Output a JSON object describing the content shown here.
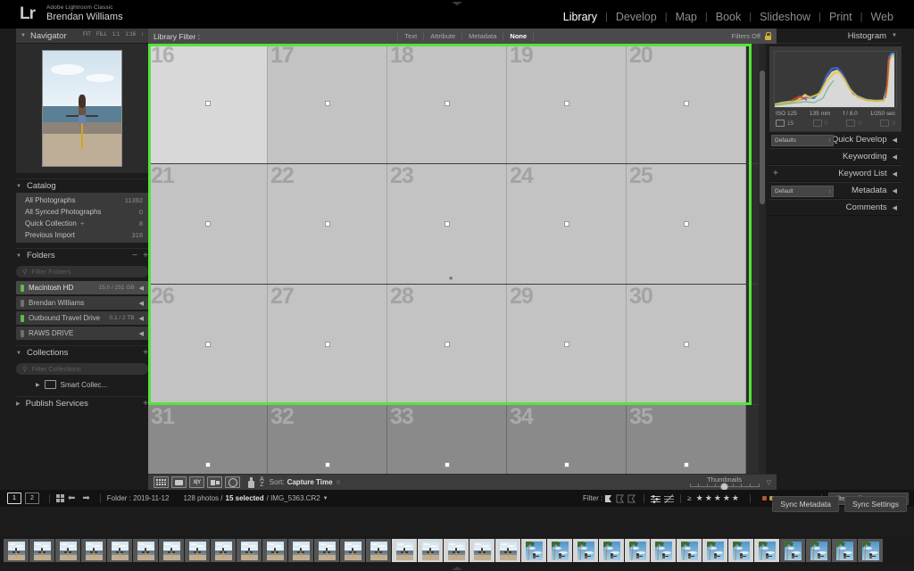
{
  "app": {
    "logo": "Lr",
    "product": "Adobe Lightroom Classic",
    "user": "Brendan Williams"
  },
  "modules": [
    {
      "label": "Library",
      "active": true
    },
    {
      "label": "Develop",
      "active": false
    },
    {
      "label": "Map",
      "active": false
    },
    {
      "label": "Book",
      "active": false
    },
    {
      "label": "Slideshow",
      "active": false
    },
    {
      "label": "Print",
      "active": false
    },
    {
      "label": "Web",
      "active": false
    }
  ],
  "left": {
    "navigator": {
      "title": "Navigator",
      "zoom_levels": [
        "FIT",
        "FILL",
        "1:1",
        "1:16"
      ]
    },
    "catalog": {
      "title": "Catalog",
      "rows": [
        {
          "label": "All Photographs",
          "count": "11392"
        },
        {
          "label": "All Synced Photographs",
          "count": "0"
        },
        {
          "label": "Quick Collection",
          "count": "8",
          "plus": "+"
        },
        {
          "label": "Previous Import",
          "count": "318"
        }
      ]
    },
    "folders": {
      "title": "Folders",
      "filter_placeholder": "Filter Folders",
      "items": [
        {
          "label": "Macintosh HD",
          "capacity": "15.0 / 251 GB",
          "selected": true,
          "online": true
        },
        {
          "label": "Brendan Williams",
          "capacity": "",
          "selected": false,
          "online": false
        },
        {
          "label": "Outbound Travel Drive",
          "capacity": "0.1 / 2 TB",
          "selected": false,
          "online": true
        },
        {
          "label": "RAWS DRIVE",
          "capacity": "",
          "selected": false,
          "online": false
        }
      ]
    },
    "collections": {
      "title": "Collections",
      "filter_placeholder": "Filter Collections",
      "items": [
        {
          "label": "Smart Collec..."
        }
      ]
    },
    "publish": {
      "title": "Publish Services"
    }
  },
  "right": {
    "histogram": {
      "title": "Histogram",
      "iso": "ISO 125",
      "focal": "135 mm",
      "aperture": "f / 8.0",
      "shutter": "1/250 sec",
      "counts": [
        {
          "value": "15",
          "icon": "photo-icon",
          "dim": false
        },
        {
          "value": "0",
          "icon": "stack-icon",
          "dim": true
        },
        {
          "value": "0",
          "icon": "video-icon",
          "dim": true
        },
        {
          "value": "0",
          "icon": "virtual-copy-icon",
          "dim": true
        }
      ]
    },
    "sections": [
      {
        "label": "Quick Develop",
        "preset": "Defaults"
      },
      {
        "label": "Keywording",
        "preset": ""
      },
      {
        "label": "Keyword List",
        "preset": "",
        "plus": "+"
      },
      {
        "label": "Metadata",
        "preset": "Default"
      },
      {
        "label": "Comments",
        "preset": ""
      }
    ],
    "sync": {
      "metadata_label": "Sync Metadata",
      "settings_label": "Sync Settings"
    }
  },
  "library_filter": {
    "label": "Library Filter :",
    "tabs": [
      {
        "label": "Text",
        "active": false
      },
      {
        "label": "Attribute",
        "active": false
      },
      {
        "label": "Metadata",
        "active": false
      },
      {
        "label": "None",
        "active": true
      }
    ],
    "filters_off": "Filters Off",
    "lock_icon": "lock-icon"
  },
  "grid": {
    "selection_color": "#53e53a",
    "rows": [
      {
        "selected": true,
        "cells": [
          {
            "index": "16",
            "active": true,
            "scene": "beach-rear"
          },
          {
            "index": "17",
            "active": false,
            "scene": "beach-rear"
          },
          {
            "index": "18",
            "active": false,
            "scene": "beach-rear"
          },
          {
            "index": "19",
            "active": false,
            "scene": "beach-rear"
          },
          {
            "index": "20",
            "active": false,
            "scene": "beach-rear"
          }
        ]
      },
      {
        "selected": true,
        "cells": [
          {
            "index": "21",
            "active": false,
            "scene": "beach-front"
          },
          {
            "index": "22",
            "active": false,
            "scene": "beach-front"
          },
          {
            "index": "23",
            "active": false,
            "scene": "beach-wide",
            "star": "★"
          },
          {
            "index": "24",
            "active": false,
            "scene": "beach-side"
          },
          {
            "index": "25",
            "active": false,
            "scene": "palm-portrait"
          }
        ]
      },
      {
        "selected": true,
        "cells": [
          {
            "index": "26",
            "active": false,
            "scene": "palm-portrait"
          },
          {
            "index": "27",
            "active": false,
            "scene": "palm-bike"
          },
          {
            "index": "28",
            "active": false,
            "scene": "palm-bike"
          },
          {
            "index": "29",
            "active": false,
            "scene": "palm-bike"
          },
          {
            "index": "30",
            "active": false,
            "scene": "palm-sun"
          }
        ]
      },
      {
        "selected": false,
        "cells": [
          {
            "index": "31",
            "active": false,
            "scene": "palm-low"
          },
          {
            "index": "32",
            "active": false,
            "scene": "palm-low"
          },
          {
            "index": "33",
            "active": false,
            "scene": "palm-low"
          },
          {
            "index": "34",
            "active": false,
            "scene": "palm-low"
          },
          {
            "index": "35",
            "active": false,
            "scene": "palm-sun"
          }
        ]
      }
    ]
  },
  "toolbar": {
    "view_icons": [
      "grid-view-icon",
      "loupe-view-icon",
      "compare-view-icon",
      "survey-view-icon",
      "people-view-icon"
    ],
    "spray_icon": "spray-can-icon",
    "sort_icon": "sort-az-icon",
    "sort_label": "Sort:",
    "sort_value": "Capture Time",
    "thumbnails_label": "Thumbnails",
    "thumbnail_size_percent": 44
  },
  "statusbar": {
    "pages": [
      {
        "label": "1",
        "active": true
      },
      {
        "label": "2",
        "active": false
      }
    ],
    "grid_icon": "grid-icon",
    "prev_icon": "arrow-left-icon",
    "next_icon": "arrow-right-icon",
    "folder_label": "Folder : 2019-11-12",
    "photo_count": "128 photos /",
    "selected_count": "15 selected",
    "filename": "/ IMG_5363.CR2",
    "filter_label": "Filter :",
    "flags": [
      "flag-picked-icon",
      "flag-unflagged-icon",
      "flag-rejected-icon"
    ],
    "attr_icons": [
      "edited-icon",
      "unedited-icon"
    ],
    "rating_prefix": "≥",
    "stars": [
      "★",
      "★",
      "★",
      "★",
      "★"
    ],
    "color_labels": [
      "#b0543c",
      "#b3a53c",
      "#4f8a42",
      "#3f5f9e",
      "#8a5f9e",
      "#6f6f6f",
      "#6f6f6f"
    ],
    "filters_off": "Filters Off"
  },
  "filmstrip": {
    "visible_cells": 34,
    "selected_from": 15,
    "selected_to": 29
  }
}
